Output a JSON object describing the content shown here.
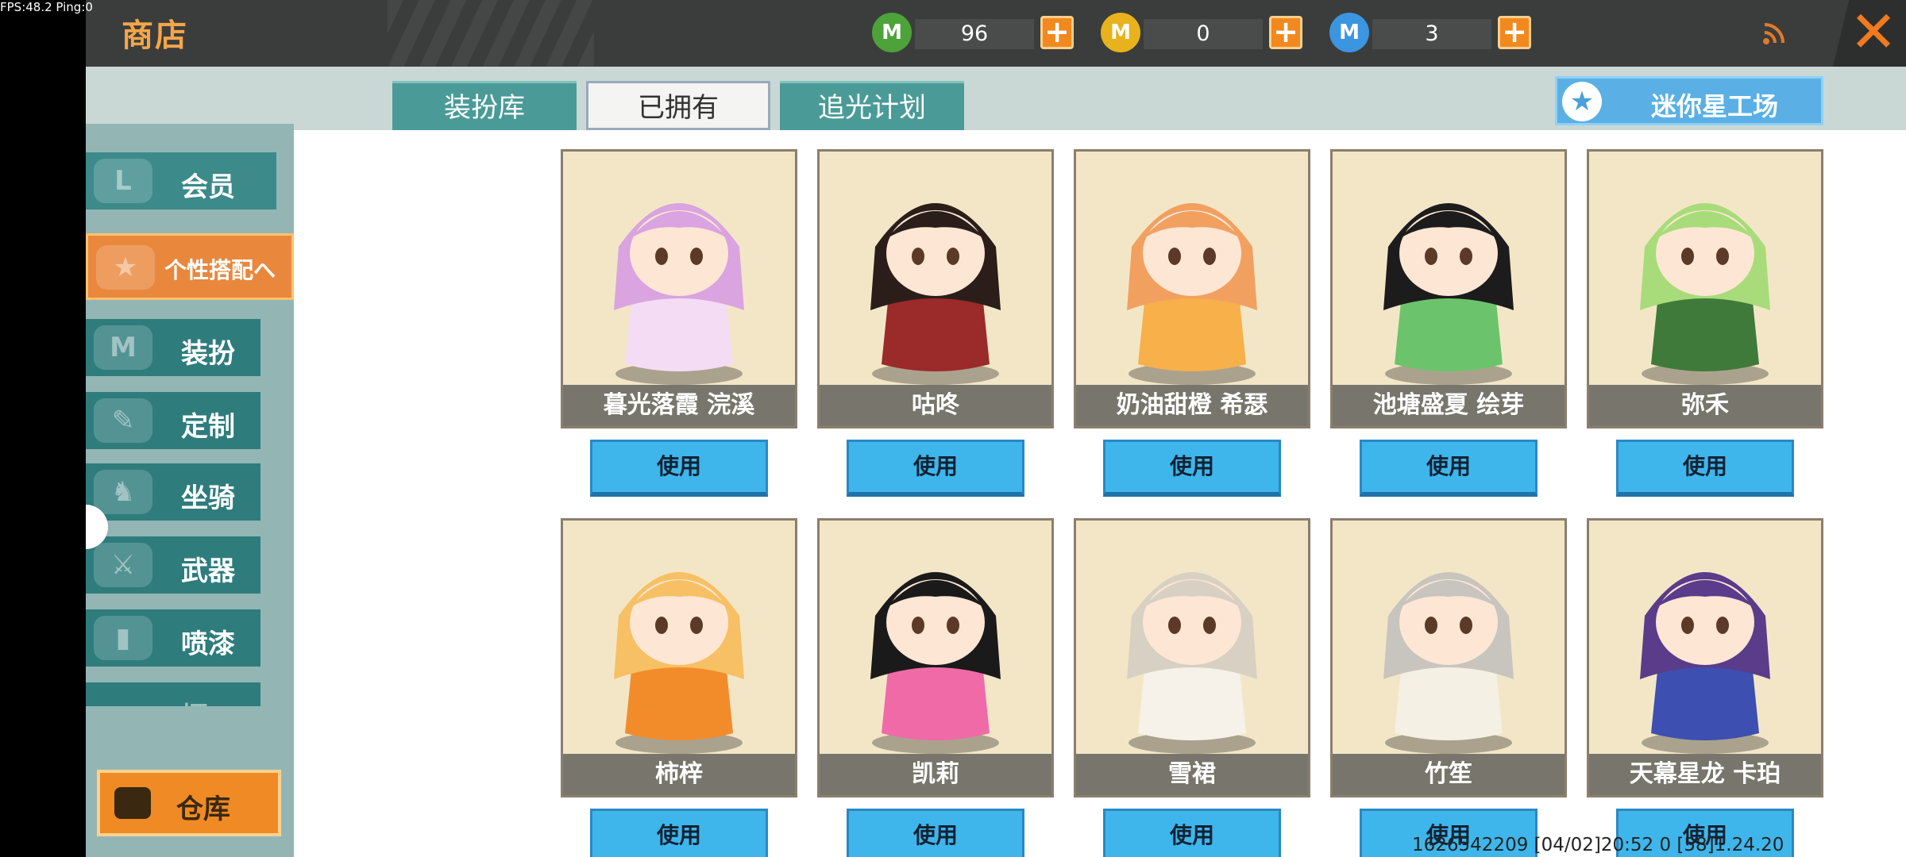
{
  "status": {
    "fps": "FPS:48.2  Ping:0"
  },
  "header": {
    "title": "商店"
  },
  "currencies": [
    {
      "icon": "green-gem-icon",
      "value": "96",
      "color": "#4ea23a",
      "letter": "M"
    },
    {
      "icon": "gold-coin-icon",
      "value": "0",
      "color": "#e8b21d",
      "letter": "M"
    },
    {
      "icon": "blue-star-coin-icon",
      "value": "3",
      "color": "#3c95e0",
      "letter": "M"
    }
  ],
  "sidebar": {
    "items": [
      {
        "label": "会员"
      },
      {
        "label": "个性搭配へ"
      },
      {
        "label": "装扮"
      },
      {
        "label": "定制"
      },
      {
        "label": "坐骑"
      },
      {
        "label": "武器"
      },
      {
        "label": "喷漆"
      },
      {
        "label": "摆..."
      }
    ],
    "warehouse": "仓库"
  },
  "tabs": [
    {
      "label": "装扮库"
    },
    {
      "label": "已拥有"
    },
    {
      "label": "追光计划"
    }
  ],
  "mini_star": {
    "label": "迷你星工场"
  },
  "cards": [
    {
      "name": "暮光落霞 浣溪",
      "hair": "#d9a4e0",
      "outfit": "#f4dcf4",
      "bg": "#f3e6c7"
    },
    {
      "name": "咕咚",
      "hair": "#2b1e1a",
      "outfit": "#9b2a2a",
      "bg": "#f3e6c7"
    },
    {
      "name": "奶油甜橙 希瑟",
      "hair": "#f2a060",
      "outfit": "#f7b04a",
      "bg": "#f3e6c7"
    },
    {
      "name": "池塘盛夏 绘芽",
      "hair": "#1c1c1c",
      "outfit": "#6bc46b",
      "bg": "#f3e6c7"
    },
    {
      "name": "弥禾",
      "hair": "#a8dc7a",
      "outfit": "#3f7a3a",
      "bg": "#f3e6c7"
    },
    {
      "name": "柿梓",
      "hair": "#f7c064",
      "outfit": "#f28c2a",
      "bg": "#f3e6c7"
    },
    {
      "name": "凯莉",
      "hair": "#1a1a1a",
      "outfit": "#f06aa8",
      "bg": "#f3e6c7"
    },
    {
      "name": "雪裙",
      "hair": "#d8d0c2",
      "outfit": "#f6f2ea",
      "bg": "#f3e6c7"
    },
    {
      "name": "竹笙",
      "hair": "#c8c4be",
      "outfit": "#f4f0e4",
      "bg": "#f3e6c7"
    },
    {
      "name": "天幕星龙 卡珀",
      "hair": "#5a3c8a",
      "outfit": "#3d4fb0",
      "bg": "#f3e6c7"
    }
  ],
  "use_label": "使用",
  "footer": {
    "info": "1626542209  [04/02]20:52 0 [58]1.24.20"
  }
}
